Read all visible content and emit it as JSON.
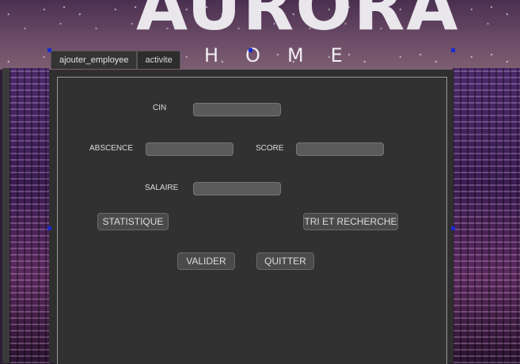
{
  "banner": {
    "title": "AURORA",
    "subtitle": "HOME"
  },
  "tabs": [
    {
      "label": "ajouter_employee"
    },
    {
      "label": "activite"
    }
  ],
  "form": {
    "cin_label": "CIN",
    "abscence_label": "ABSCENCE",
    "score_label": "SCORE",
    "salaire_label": "SALAIRE",
    "cin_value": "",
    "abscence_value": "",
    "score_value": "",
    "salaire_value": ""
  },
  "buttons": {
    "statistique": "STATISTIQUE",
    "tri_recherche": "TRI ET RECHERCHE",
    "valider": "VALIDER",
    "quitter": "QUITTER"
  },
  "colors": {
    "panel": "#2f2f2f",
    "field": "#5a5a5a",
    "button": "#4a4a4a",
    "selection_handle": "#1a2bd0"
  }
}
